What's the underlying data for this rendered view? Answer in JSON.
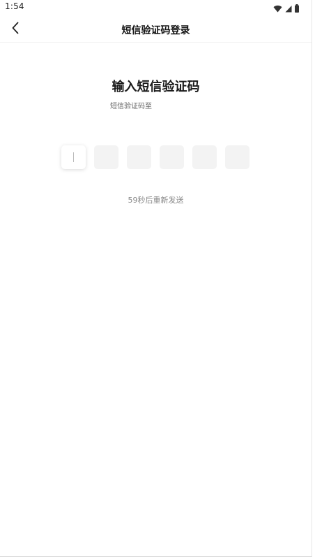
{
  "status_bar": {
    "time": "1:54",
    "icons": [
      "wifi-icon",
      "cellular-signal-icon",
      "battery-icon"
    ]
  },
  "nav": {
    "back_icon": "chevron-left-icon",
    "title": "短信验证码登录"
  },
  "main": {
    "heading": "输入短信验证码",
    "subtitle": "短信验证码至",
    "code_boxes": [
      "",
      "",
      "",
      "",
      "",
      ""
    ],
    "active_box_index": 0,
    "resend_text": "59秒后重新发送"
  },
  "colors": {
    "background": "#ffffff",
    "box_fill": "#f3f3f3",
    "heading": "#1a1a1a",
    "muted_text": "#888888"
  }
}
